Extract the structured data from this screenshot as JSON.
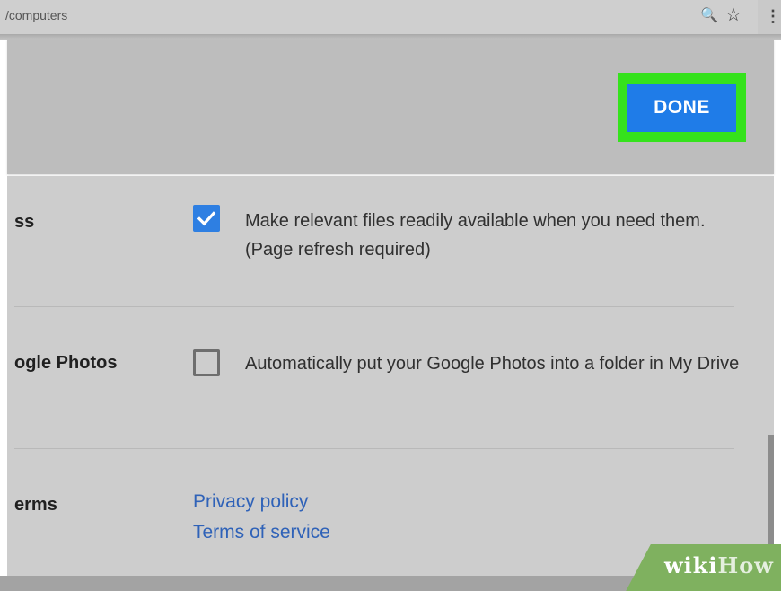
{
  "browser": {
    "url_fragment": "/computers",
    "zoom_icon": "zoom-icon",
    "bookmark_icon": "star-icon",
    "menu_icon": "menu-kebab-icon",
    "zoom_glyph": "🔍",
    "star_glyph": "☆",
    "menu_glyph": "⋮"
  },
  "dialog": {
    "done_label": "DONE",
    "accent_color": "#1f7ce8",
    "highlight_color": "#35e21c"
  },
  "settings": [
    {
      "title": "ss",
      "checked": true,
      "description": "Make relevant files readily available when you need them. (Page refresh required)"
    },
    {
      "title": "ogle Photos",
      "checked": false,
      "description": "Automatically put your Google Photos into a folder in My Drive"
    }
  ],
  "terms": {
    "title": "erms",
    "privacy_link": "Privacy policy",
    "terms_link": "Terms of service"
  },
  "watermark": {
    "part1": "wiki",
    "part2": "How"
  }
}
